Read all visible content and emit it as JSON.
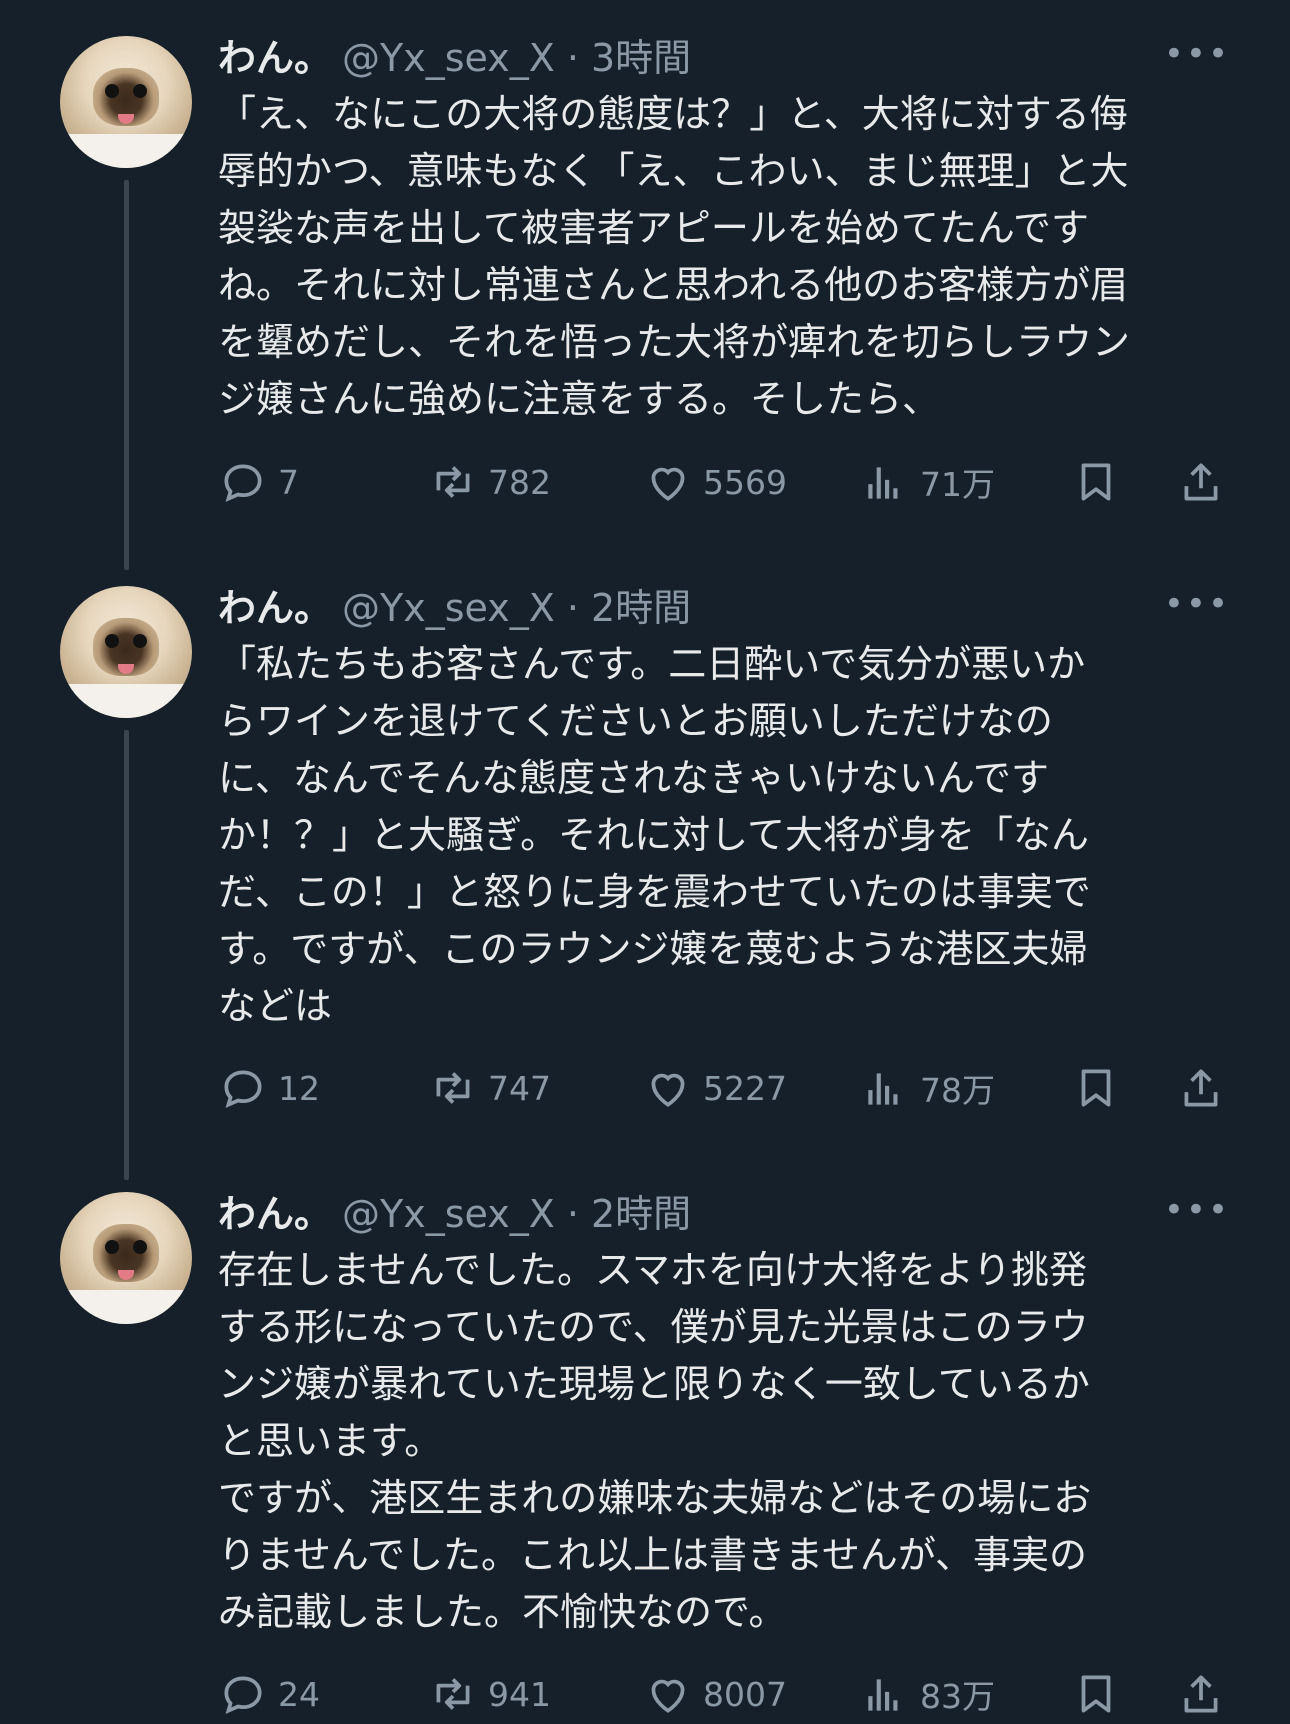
{
  "tweets": [
    {
      "name": "わん。",
      "handle": "@Yx_sex_X · 3時間",
      "text": "「え、なにこの大将の態度は？」と、大将に対する侮\n辱的かつ、意味もなく「え、こわい、まじ無理」と大\n袈裟な声を出して被害者アピールを始めてたんです\nね。それに対し常連さんと思われる他のお客様方が眉\nを顰めだし、それを悟った大将が痺れを切らしラウン\nジ嬢さんに強めに注意をする。そしたら、",
      "replies": "7",
      "retweets": "782",
      "likes": "5569",
      "views": "71万"
    },
    {
      "name": "わん。",
      "handle": "@Yx_sex_X · 2時間",
      "text": "「私たちもお客さんです。二日酔いで気分が悪いか\nらワインを退けてくださいとお願いしただけなの\nに、なんでそんな態度されなきゃいけないんです\nか！？」と大騒ぎ。それに対して大将が身を「なん\nだ、この！」と怒りに身を震わせていたのは事実で\nす。ですが、このラウンジ嬢を蔑むような港区夫婦\nなどは",
      "replies": "12",
      "retweets": "747",
      "likes": "5227",
      "views": "78万"
    },
    {
      "name": "わん。",
      "handle": "@Yx_sex_X · 2時間",
      "text": "存在しませんでした。スマホを向け大将をより挑発\nする形になっていたので、僕が見た光景はこのラウ\nンジ嬢が暴れていた現場と限りなく一致しているか\nと思います。\nですが、港区生まれの嫌味な夫婦などはその場にお\nりませんでした。これ以上は書きませんが、事実の\nみ記載しました。不愉快なので。",
      "replies": "24",
      "retweets": "941",
      "likes": "8007",
      "views": "83万"
    }
  ],
  "more_label": "•••"
}
